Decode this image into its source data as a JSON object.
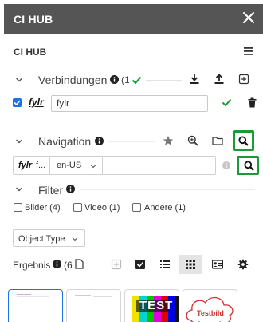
{
  "titlebar": {
    "title": "CI HUB",
    "close_icon": "close-icon"
  },
  "header": {
    "title": "CI HUB",
    "menu_icon": "hamburger-menu-icon"
  },
  "connections": {
    "label": "Verbindungen",
    "count_text": "(1",
    "connection": {
      "logo": "fylr",
      "name": "fylr",
      "checked": true
    }
  },
  "navigation": {
    "label": "Navigation",
    "source_logo": "fylr",
    "source_text": "f...",
    "language": "en-US",
    "search_placeholder": ""
  },
  "filter": {
    "label": "Filter",
    "options": [
      {
        "label": "Bilder (4)",
        "checked": false
      },
      {
        "label": "Video (1)",
        "checked": false
      },
      {
        "label": "Andere (1)",
        "checked": false
      }
    ],
    "object_type": "Object Type"
  },
  "results": {
    "label": "Ergebnis",
    "count_text": "(6"
  },
  "thumbnails": [
    {
      "caption": ""
    },
    {
      "caption": ""
    },
    {
      "caption": "TEST"
    },
    {
      "caption": "Testbild"
    }
  ],
  "colors": {
    "accent_green": "#1a9b3a",
    "checkbox_blue": "#1a73e8",
    "titlebar_bg": "#555555"
  }
}
